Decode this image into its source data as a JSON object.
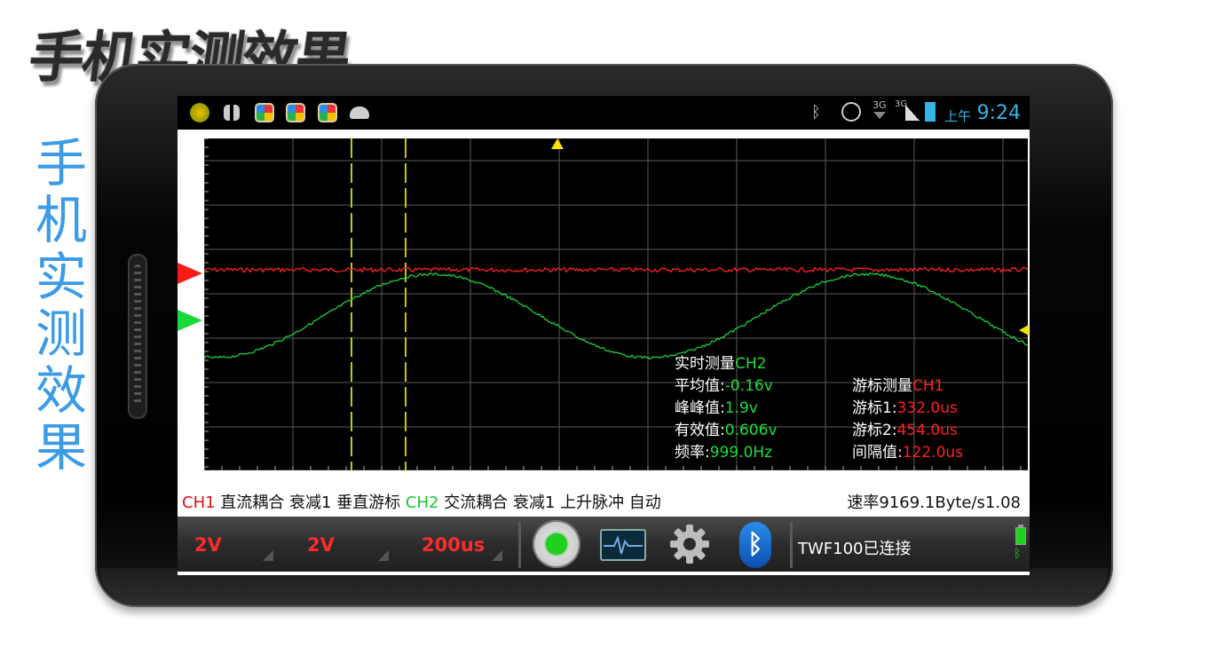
{
  "decor": {
    "top_title": "手机实测效果",
    "side_title": "手机实测效果"
  },
  "statusbar": {
    "network_1": "3G",
    "network_2": "3G",
    "ampm": "上午",
    "time": "9:24",
    "icons": [
      "app-icon",
      "grid-icon",
      "app-icon",
      "app-icon",
      "app-icon",
      "android-icon",
      "bluetooth-icon",
      "alarm-icon",
      "signal-icon",
      "signal-icon",
      "battery-icon"
    ]
  },
  "scope": {
    "measure_title_prefix": "实时测量",
    "measure_channel": "CH2",
    "avg_label": "平均值:",
    "avg_value": "-0.16v",
    "pp_label": "峰峰值:",
    "pp_value": "1.9v",
    "rms_label": "有效值:",
    "rms_value": "0.606v",
    "freq_label": "频率:",
    "freq_value": "999.0Hz",
    "cursor_title_prefix": "游标测量",
    "cursor_channel": "CH1",
    "cursor1_label": "游标1:",
    "cursor1_value": "332.0us",
    "cursor2_label": "游标2:",
    "cursor2_value": "454.0us",
    "interval_label": "间隔值:",
    "interval_value": "122.0us",
    "colors": {
      "ch1": "#ff2020",
      "ch2": "#19e03a",
      "cursor": "#c8c800",
      "grid": "#5a5a5a"
    }
  },
  "info": {
    "ch1": "CH1",
    "ch1_settings": " 直流耦合 衰减1 垂直游标 ",
    "ch2": "CH2",
    "ch2_settings": " 交流耦合 衰减1 上升脉冲 自动",
    "rate": "速率9169.1Byte/s1.08"
  },
  "toolbar": {
    "ch1_volt": "2V",
    "ch2_volt": "2V",
    "timebase": "200us",
    "connection": "TWF100已连接",
    "bt_glyph": "ᛒ"
  }
}
